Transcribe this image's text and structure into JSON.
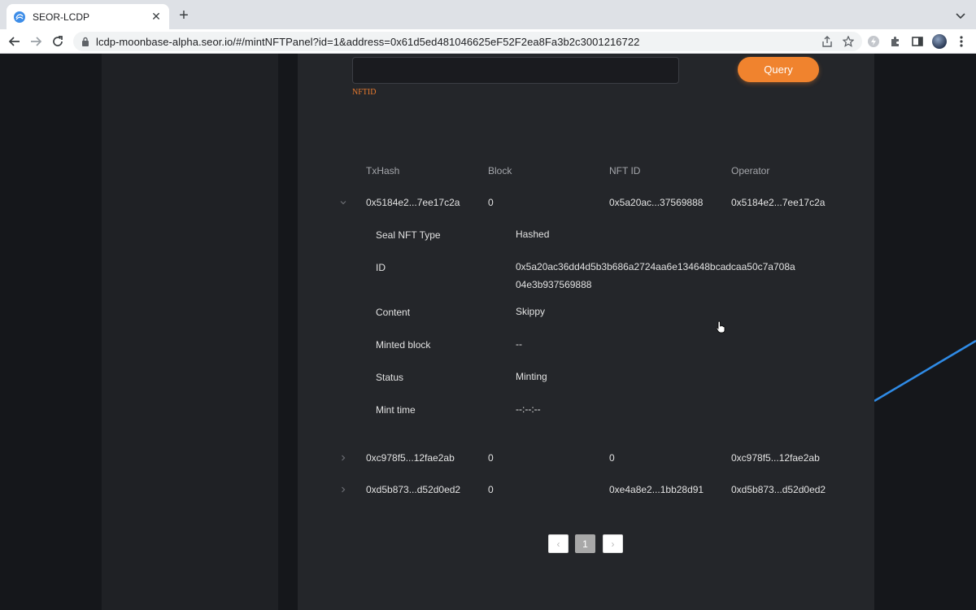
{
  "browser": {
    "tab_title": "SEOR-LCDP",
    "url": "lcdp-moonbase-alpha.seor.io/#/mintNFTPanel?id=1&address=0x61d5ed481046625eF52F2ea8Fa3b2c3001216722"
  },
  "query": {
    "input_value": "",
    "input_label": "NFTID",
    "button_label": "Query"
  },
  "table": {
    "headers": [
      "TxHash",
      "Block",
      "NFT ID",
      "Operator"
    ],
    "rows": [
      {
        "txhash": "0x5184e2...7ee17c2a",
        "block": "0",
        "nft_id": "0x5a20ac...37569888",
        "operator": "0x5184e2...7ee17c2a",
        "expanded": true
      },
      {
        "txhash": "0xc978f5...12fae2ab",
        "block": "0",
        "nft_id": "0",
        "operator": "0xc978f5...12fae2ab",
        "expanded": false
      },
      {
        "txhash": "0xd5b873...d52d0ed2",
        "block": "0",
        "nft_id": "0xe4a8e2...1bb28d91",
        "operator": "0xd5b873...d52d0ed2",
        "expanded": false
      }
    ],
    "details": [
      {
        "label": "Seal NFT Type",
        "value": "Hashed"
      },
      {
        "label": "ID",
        "value": "0x5a20ac36dd4d5b3b686a2724aa6e134648bcadcaa50c7a708a04e3b937569888"
      },
      {
        "label": "Content",
        "value": "Skippy"
      },
      {
        "label": "Minted block",
        "value": "--"
      },
      {
        "label": "Status",
        "value": "Minting"
      },
      {
        "label": "Mint time",
        "value": "--:--:--"
      }
    ]
  },
  "pagination": {
    "prev": "‹",
    "current": "1",
    "next": "›"
  },
  "colors": {
    "accent": "#f0832e",
    "deco_line": "#2f8be6"
  }
}
